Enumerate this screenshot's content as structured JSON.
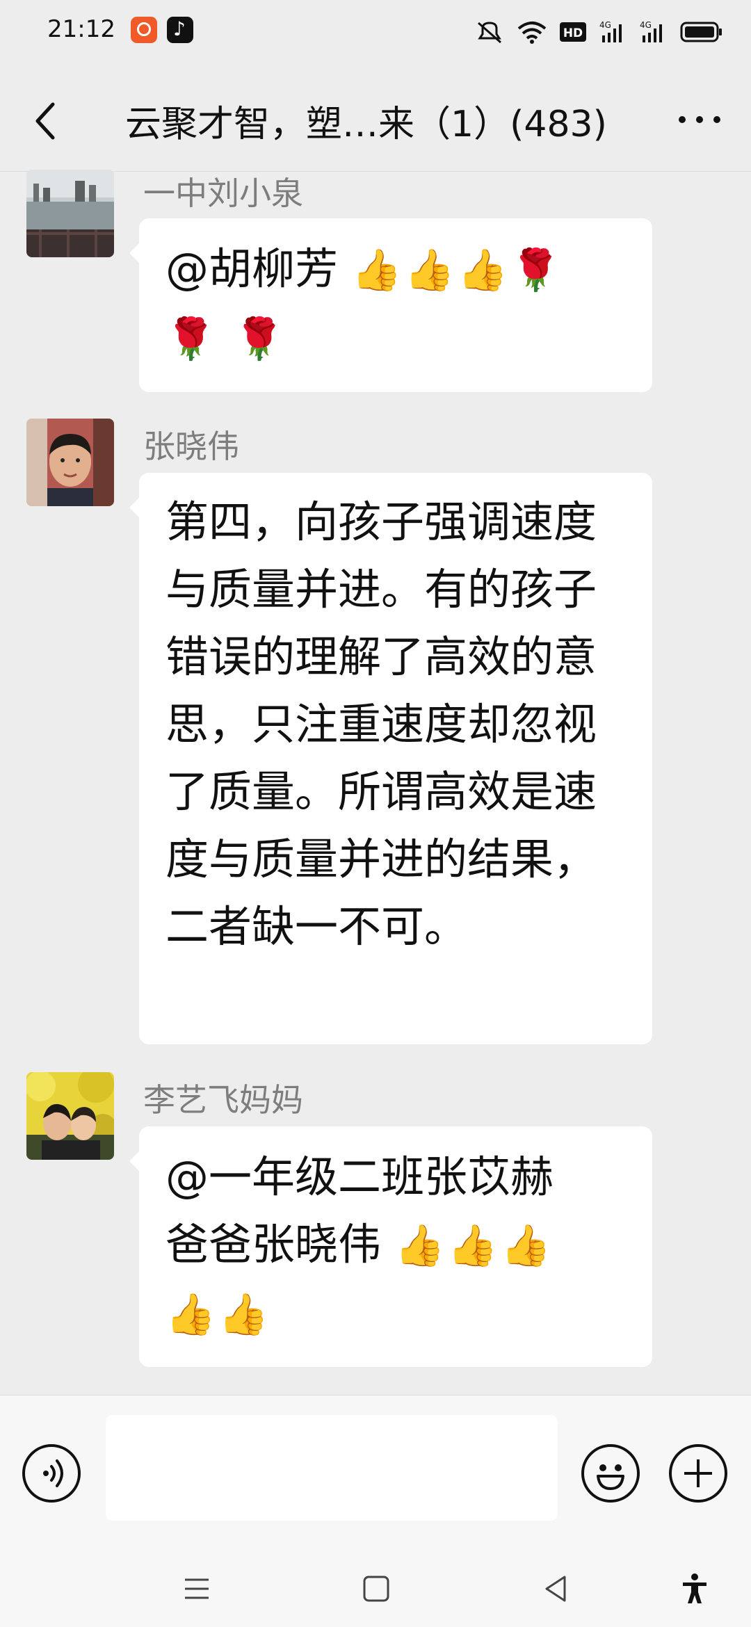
{
  "status_bar": {
    "time": "21:12",
    "icons": [
      "app-notification-icon",
      "tiktok-icon",
      "mute-icon",
      "wifi-icon",
      "hd-icon",
      "signal-4g-icon",
      "signal-4g-icon",
      "battery-icon"
    ],
    "hd_text": "HD",
    "network_1": "4G",
    "network_2": "4G"
  },
  "header": {
    "title": "云聚才智，塑…来（1）(483)",
    "back_icon": "chevron-left-icon",
    "more_icon": "more-dots-icon"
  },
  "messages": [
    {
      "sender": "一中刘小泉",
      "text": "@胡柳芳 ",
      "emojis_line1": "👍👍👍🌹",
      "emojis_line2": "🌹 🌹"
    },
    {
      "sender": "张晓伟",
      "text": "第四，向孩子强调速度与质量并进。有的孩子错误的理解了高效的意思，只注重速度却忽视了质量。所谓高效是速度与质量并进的结果，二者缺一不可。"
    },
    {
      "sender": "李艺飞妈妈",
      "text_line1": "@一年级二班张苡赫",
      "text_line2": "爸爸张晓伟 ",
      "emojis_line2": "👍👍👍",
      "emojis_line3": "👍👍"
    }
  ],
  "input_bar": {
    "voice_icon": "voice-icon",
    "text_value": "",
    "emoji_icon": "emoji-smile-icon",
    "plus_icon": "plus-icon"
  },
  "nav_bar": {
    "icons": [
      "menu-icon",
      "home-square-icon",
      "back-triangle-icon",
      "accessibility-icon"
    ]
  },
  "colors": {
    "background": "#ededed",
    "bubble": "#ffffff",
    "sender_name": "#7d7d7d"
  }
}
